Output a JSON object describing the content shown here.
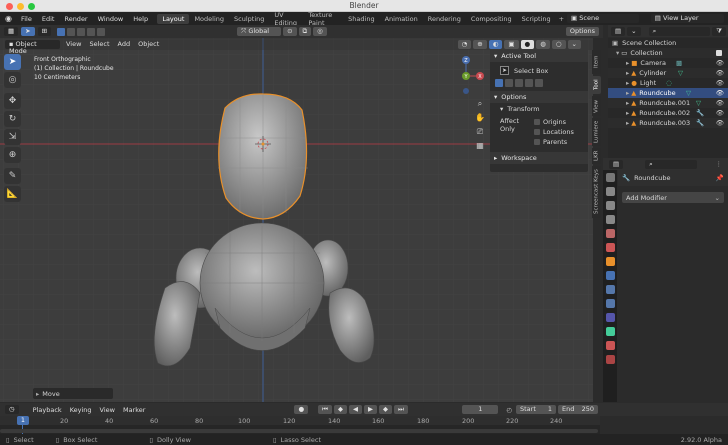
{
  "window": {
    "title": "Blender"
  },
  "menu": [
    "File",
    "Edit",
    "Render",
    "Window",
    "Help"
  ],
  "workspaces": [
    "Layout",
    "Modeling",
    "Sculpting",
    "UV Editing",
    "Texture Paint",
    "Shading",
    "Animation",
    "Rendering",
    "Compositing",
    "Scripting"
  ],
  "scene": {
    "scene_name": "Scene",
    "view_layer": "View Layer"
  },
  "viewport_header": {
    "mode": "Object Mode",
    "menus": [
      "View",
      "Select",
      "Add",
      "Object"
    ],
    "orientation": "Global",
    "options": "Options"
  },
  "overlay_text": {
    "line1": "Front Orthographic",
    "line2": "(1) Collection | Roundcube",
    "line3": "10 Centimeters"
  },
  "gizmo": {
    "x": "X",
    "y": "Y",
    "z": "Z"
  },
  "npanel": {
    "active_tool_title": "Active Tool",
    "select_box": "Select Box",
    "options_title": "Options",
    "transform_title": "Transform",
    "affect_only": "Affect Only",
    "origins": "Origins",
    "locations": "Locations",
    "parents": "Parents",
    "workspace_title": "Workspace",
    "tabs": [
      "Item",
      "Tool",
      "View",
      "Lumiere",
      "LKR",
      "Screencast Keys"
    ]
  },
  "last_op": "Move",
  "outliner": {
    "root": "Scene Collection",
    "collection": "Collection",
    "items": [
      "Camera",
      "Cylinder",
      "Light",
      "Roundcube",
      "Roundcube.001",
      "Roundcube.002",
      "Roundcube.003"
    ]
  },
  "properties": {
    "object_name": "Roundcube",
    "add_modifier": "Add Modifier"
  },
  "timeline": {
    "menus": [
      "Playback",
      "Keying",
      "View",
      "Marker"
    ],
    "current_frame": "1",
    "start_label": "Start",
    "start": "1",
    "end_label": "End",
    "end": "250",
    "ticks": [
      "1",
      "20",
      "40",
      "60",
      "80",
      "100",
      "120",
      "140",
      "160",
      "180",
      "200",
      "220",
      "240"
    ]
  },
  "status": {
    "select": "Select",
    "box_select": "Box Select",
    "dolly_view": "Dolly View",
    "lasso_select": "Lasso Select",
    "version": "2.92.0 Alpha"
  },
  "colors": {
    "accent": "#4772b3",
    "selection": "#e8902b",
    "x_axis": "#c84a50",
    "y_axis": "#6a9a2a",
    "z_axis": "#4a6fb0"
  }
}
